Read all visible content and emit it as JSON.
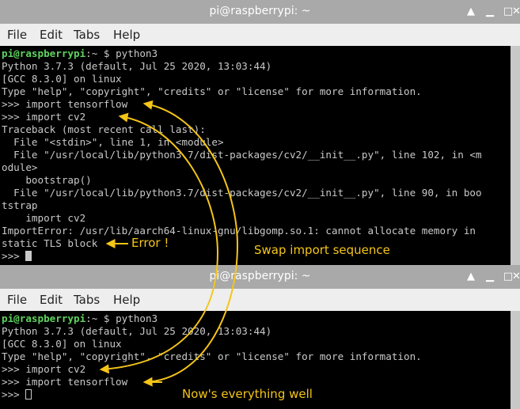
{
  "window1": {
    "title": "pi@raspberrypi: ~",
    "menu": [
      "File",
      "Edit",
      "Tabs",
      "Help"
    ],
    "prompt_user": "pi@raspberrypi",
    "prompt_rest": ":~ $ python3",
    "lines": [
      "Python 3.7.3 (default, Jul 25 2020, 13:03:44)",
      "[GCC 8.3.0] on linux",
      "Type \"help\", \"copyright\", \"credits\" or \"license\" for more information.",
      ">>> import tensorflow",
      ">>> import cv2",
      "Traceback (most recent call last):",
      "  File \"<stdin>\", line 1, in <module>",
      "  File \"/usr/local/lib/python3.7/dist-packages/cv2/__init__.py\", line 102, in <m",
      "odule>",
      "    bootstrap()",
      "  File \"/usr/local/lib/python3.7/dist-packages/cv2/__init__.py\", line 90, in boo",
      "tstrap",
      "    import cv2",
      "ImportError: /usr/lib/aarch64-linux-gnu/libgomp.so.1: cannot allocate memory in",
      "static TLS block"
    ],
    "last_prompt": ">>> "
  },
  "window2": {
    "title": "pi@raspberrypi: ~",
    "menu": [
      "File",
      "Edit",
      "Tabs",
      "Help"
    ],
    "prompt_user": "pi@raspberrypi",
    "prompt_rest": ":~ $ python3",
    "lines": [
      "Python 3.7.3 (default, Jul 25 2020, 13:03:44)",
      "[GCC 8.3.0] on linux",
      "Type \"help\", \"copyright\", \"credits\" or \"license\" for more information.",
      ">>> import cv2",
      ">>> import tensorflow"
    ],
    "last_prompt": ">>> "
  },
  "annotations": {
    "error": "Error !",
    "swap": "Swap import sequence",
    "well": "Now's everything well"
  },
  "colors": {
    "annotation": "#f5c518",
    "prompt": "#5fd35f",
    "terminal_bg": "#000000",
    "terminal_fg": "#c9c9c9",
    "titlebar": "#a9a9a9"
  },
  "icons": [
    "chevron-up-icon",
    "minimize-icon",
    "maximize-icon",
    "close-icon"
  ]
}
